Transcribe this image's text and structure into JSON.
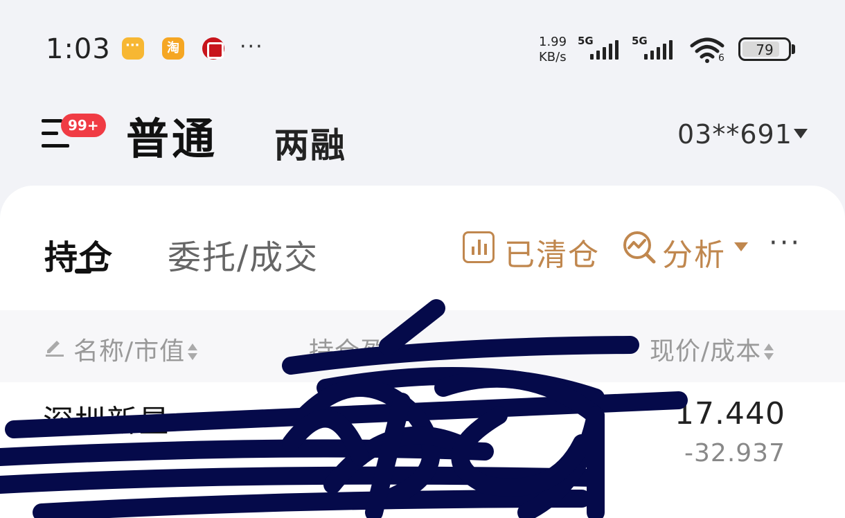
{
  "status_bar": {
    "time": "1:03",
    "net_speed_value": "1.99",
    "net_speed_unit": "KB/s",
    "signal1_label": "5G",
    "signal2_label": "5G",
    "wifi_label": "6",
    "battery_level": "79",
    "taobao_icon_text": "淘",
    "more_notifications": "···",
    "notification_icons": [
      "chat-bubble-icon",
      "taobao-icon",
      "bank-icon"
    ]
  },
  "header": {
    "badge": "99+",
    "mode_normal": "普通",
    "mode_margin": "两融",
    "account": "03**691"
  },
  "tabs": {
    "positions": "持仓",
    "orders": "委托/成交"
  },
  "actions": {
    "cleared": "已清仓",
    "analysis": "分析",
    "more": "···"
  },
  "table": {
    "headers": {
      "name_value": "名称/市值",
      "position": "持仓盈",
      "price_cost": "现价/成本"
    },
    "rows": [
      {
        "name": "深圳新星",
        "price": "17.440",
        "cost": "-32.937"
      }
    ]
  },
  "colors": {
    "accent": "#c0874e",
    "badge": "#f03b44",
    "background": "#f2f3f7",
    "card": "#ffffff",
    "redaction": "#050a4a"
  }
}
